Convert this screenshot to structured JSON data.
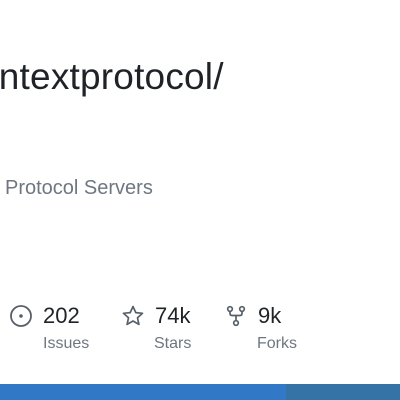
{
  "repo": {
    "path_text": "ontextprotocol/",
    "description": "Protocol Servers"
  },
  "stats": {
    "issues": {
      "value": "202",
      "label": "Issues",
      "icon": "issue-opened-icon"
    },
    "stars": {
      "value": "74k",
      "label": "Stars",
      "icon": "star-icon"
    },
    "forks": {
      "value": "9k",
      "label": "Forks",
      "icon": "repo-forked-icon"
    }
  },
  "language_bar": {
    "segments": [
      {
        "share": 0.715,
        "color": "#3178c6"
      },
      {
        "share": 0.285,
        "color": "#3572a5"
      }
    ]
  },
  "colors": {
    "text_primary": "#1f2328",
    "text_muted": "#6e7781",
    "icon": "#57606a"
  }
}
